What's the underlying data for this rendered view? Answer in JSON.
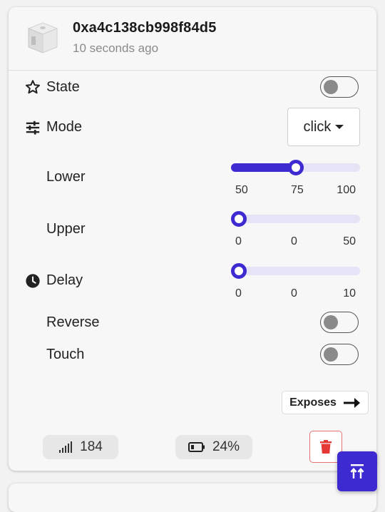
{
  "device": {
    "id": "0xa4c138cb998f84d5",
    "last_seen": "10 seconds ago",
    "image_icon": "fingerbot-device-icon"
  },
  "controls": {
    "state": {
      "label": "State",
      "icon": "star-icon",
      "value": false
    },
    "mode": {
      "label": "Mode",
      "icon": "sliders-icon",
      "selected": "click"
    },
    "lower": {
      "label": "Lower",
      "min": "50",
      "mid": "75",
      "max": "100",
      "value": 0.5
    },
    "upper": {
      "label": "Upper",
      "min": "0",
      "mid": "0",
      "max": "50",
      "value": 0
    },
    "delay": {
      "label": "Delay",
      "icon": "clock-icon",
      "min": "0",
      "mid": "0",
      "max": "10",
      "value": 0
    },
    "reverse": {
      "label": "Reverse",
      "value": false
    },
    "touch": {
      "label": "Touch",
      "value": false
    }
  },
  "footer": {
    "exposes_label": "Exposes",
    "linkquality": "184",
    "battery": "24%",
    "icons": [
      "signal-icon",
      "battery-icon",
      "trash-icon",
      "arrow-right-icon"
    ]
  },
  "fab": {
    "icon": "scroll-to-top-icon"
  },
  "colors": {
    "accent": "#3d2bd1",
    "danger": "#e53935",
    "track": "#e6e3f6"
  }
}
